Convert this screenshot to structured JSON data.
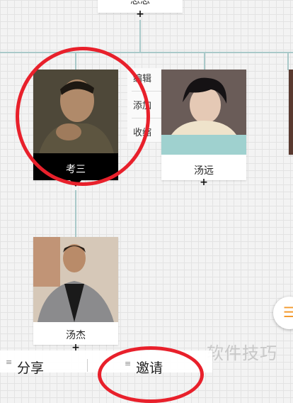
{
  "top_node": {
    "name": "思思"
  },
  "nodes": [
    {
      "name": "考三",
      "selected": true
    },
    {
      "name": "汤远"
    },
    {
      "name": "汤杰"
    }
  ],
  "context_menu": {
    "items": [
      "编辑",
      "添加",
      "收缩"
    ]
  },
  "bottom_bar": {
    "share_label": "分享",
    "invite_label": "邀请",
    "menu_glyph": "≡"
  },
  "watermark": "软件技巧",
  "float_button": {
    "icon": "list-icon"
  },
  "colors": {
    "accent_red": "#e8202b",
    "connector": "#a9c9c9",
    "selected_label_bg": "#000000",
    "teal_strip": "#9fd1cf"
  }
}
